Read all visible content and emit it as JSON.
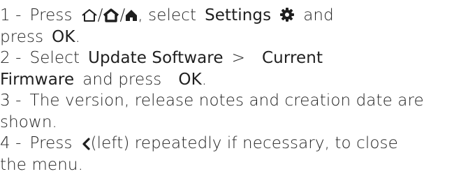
{
  "steps": [
    {
      "number": "1 -",
      "press": "Press",
      "slash1": "/",
      "slash2": "/",
      "comma_select": ", select",
      "settings": "Settings",
      "and": "and",
      "press_lower": "press",
      "ok": "OK",
      "period": "."
    },
    {
      "number": "2 -",
      "select": "Select",
      "update_software": "Update Software",
      "arrow": ">",
      "current": "Current",
      "firmware": "Firmware",
      "and_press": "and press",
      "ok": "OK",
      "period": "."
    },
    {
      "number": "3 -",
      "text_a": "The version, release notes and creation date are",
      "text_b": "shown."
    },
    {
      "number": "4 -",
      "press": "Press",
      "left_hint": "(left) repeatedly if necessary, to close",
      "text_b": "the menu."
    }
  ],
  "icons": {
    "home_outline": "home-outline-icon",
    "home_thick": "home-bold-icon",
    "home_filled": "home-filled-icon",
    "settings": "gear-icon",
    "back": "chevron-left-icon"
  }
}
